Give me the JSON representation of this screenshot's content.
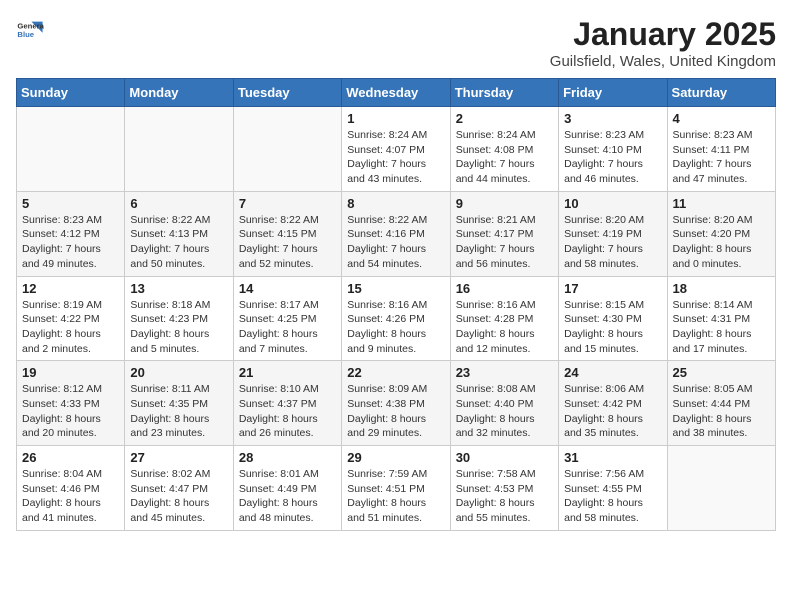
{
  "logo": {
    "text_general": "General",
    "text_blue": "Blue"
  },
  "title": "January 2025",
  "subtitle": "Guilsfield, Wales, United Kingdom",
  "days_of_week": [
    "Sunday",
    "Monday",
    "Tuesday",
    "Wednesday",
    "Thursday",
    "Friday",
    "Saturday"
  ],
  "weeks": [
    [
      {
        "day": "",
        "info": ""
      },
      {
        "day": "",
        "info": ""
      },
      {
        "day": "",
        "info": ""
      },
      {
        "day": "1",
        "info": "Sunrise: 8:24 AM\nSunset: 4:07 PM\nDaylight: 7 hours\nand 43 minutes."
      },
      {
        "day": "2",
        "info": "Sunrise: 8:24 AM\nSunset: 4:08 PM\nDaylight: 7 hours\nand 44 minutes."
      },
      {
        "day": "3",
        "info": "Sunrise: 8:23 AM\nSunset: 4:10 PM\nDaylight: 7 hours\nand 46 minutes."
      },
      {
        "day": "4",
        "info": "Sunrise: 8:23 AM\nSunset: 4:11 PM\nDaylight: 7 hours\nand 47 minutes."
      }
    ],
    [
      {
        "day": "5",
        "info": "Sunrise: 8:23 AM\nSunset: 4:12 PM\nDaylight: 7 hours\nand 49 minutes."
      },
      {
        "day": "6",
        "info": "Sunrise: 8:22 AM\nSunset: 4:13 PM\nDaylight: 7 hours\nand 50 minutes."
      },
      {
        "day": "7",
        "info": "Sunrise: 8:22 AM\nSunset: 4:15 PM\nDaylight: 7 hours\nand 52 minutes."
      },
      {
        "day": "8",
        "info": "Sunrise: 8:22 AM\nSunset: 4:16 PM\nDaylight: 7 hours\nand 54 minutes."
      },
      {
        "day": "9",
        "info": "Sunrise: 8:21 AM\nSunset: 4:17 PM\nDaylight: 7 hours\nand 56 minutes."
      },
      {
        "day": "10",
        "info": "Sunrise: 8:20 AM\nSunset: 4:19 PM\nDaylight: 7 hours\nand 58 minutes."
      },
      {
        "day": "11",
        "info": "Sunrise: 8:20 AM\nSunset: 4:20 PM\nDaylight: 8 hours\nand 0 minutes."
      }
    ],
    [
      {
        "day": "12",
        "info": "Sunrise: 8:19 AM\nSunset: 4:22 PM\nDaylight: 8 hours\nand 2 minutes."
      },
      {
        "day": "13",
        "info": "Sunrise: 8:18 AM\nSunset: 4:23 PM\nDaylight: 8 hours\nand 5 minutes."
      },
      {
        "day": "14",
        "info": "Sunrise: 8:17 AM\nSunset: 4:25 PM\nDaylight: 8 hours\nand 7 minutes."
      },
      {
        "day": "15",
        "info": "Sunrise: 8:16 AM\nSunset: 4:26 PM\nDaylight: 8 hours\nand 9 minutes."
      },
      {
        "day": "16",
        "info": "Sunrise: 8:16 AM\nSunset: 4:28 PM\nDaylight: 8 hours\nand 12 minutes."
      },
      {
        "day": "17",
        "info": "Sunrise: 8:15 AM\nSunset: 4:30 PM\nDaylight: 8 hours\nand 15 minutes."
      },
      {
        "day": "18",
        "info": "Sunrise: 8:14 AM\nSunset: 4:31 PM\nDaylight: 8 hours\nand 17 minutes."
      }
    ],
    [
      {
        "day": "19",
        "info": "Sunrise: 8:12 AM\nSunset: 4:33 PM\nDaylight: 8 hours\nand 20 minutes."
      },
      {
        "day": "20",
        "info": "Sunrise: 8:11 AM\nSunset: 4:35 PM\nDaylight: 8 hours\nand 23 minutes."
      },
      {
        "day": "21",
        "info": "Sunrise: 8:10 AM\nSunset: 4:37 PM\nDaylight: 8 hours\nand 26 minutes."
      },
      {
        "day": "22",
        "info": "Sunrise: 8:09 AM\nSunset: 4:38 PM\nDaylight: 8 hours\nand 29 minutes."
      },
      {
        "day": "23",
        "info": "Sunrise: 8:08 AM\nSunset: 4:40 PM\nDaylight: 8 hours\nand 32 minutes."
      },
      {
        "day": "24",
        "info": "Sunrise: 8:06 AM\nSunset: 4:42 PM\nDaylight: 8 hours\nand 35 minutes."
      },
      {
        "day": "25",
        "info": "Sunrise: 8:05 AM\nSunset: 4:44 PM\nDaylight: 8 hours\nand 38 minutes."
      }
    ],
    [
      {
        "day": "26",
        "info": "Sunrise: 8:04 AM\nSunset: 4:46 PM\nDaylight: 8 hours\nand 41 minutes."
      },
      {
        "day": "27",
        "info": "Sunrise: 8:02 AM\nSunset: 4:47 PM\nDaylight: 8 hours\nand 45 minutes."
      },
      {
        "day": "28",
        "info": "Sunrise: 8:01 AM\nSunset: 4:49 PM\nDaylight: 8 hours\nand 48 minutes."
      },
      {
        "day": "29",
        "info": "Sunrise: 7:59 AM\nSunset: 4:51 PM\nDaylight: 8 hours\nand 51 minutes."
      },
      {
        "day": "30",
        "info": "Sunrise: 7:58 AM\nSunset: 4:53 PM\nDaylight: 8 hours\nand 55 minutes."
      },
      {
        "day": "31",
        "info": "Sunrise: 7:56 AM\nSunset: 4:55 PM\nDaylight: 8 hours\nand 58 minutes."
      },
      {
        "day": "",
        "info": ""
      }
    ]
  ]
}
